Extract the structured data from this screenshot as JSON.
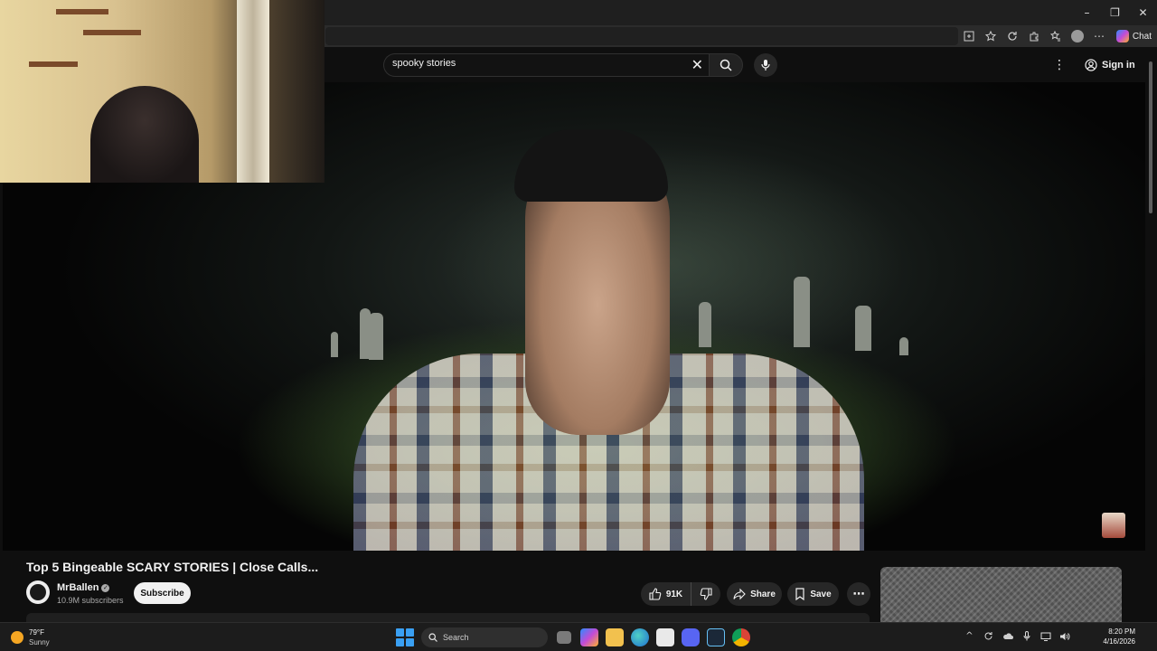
{
  "browser": {
    "minimize_glyph": "–",
    "maximize_glyph": "❐",
    "close_glyph": "✕",
    "chat_label": "Chat",
    "more_glyph": "⋯"
  },
  "youtube": {
    "search": {
      "value": "spooky stories",
      "clear_glyph": "✕"
    },
    "sign_in_label": "Sign in",
    "kebab_glyph": "⋮"
  },
  "video": {
    "title": "Top 5 Bingeable SCARY STORIES | Close Calls...",
    "channel_name": "MrBallen",
    "verified_glyph": "✓",
    "subscribers": "10.9M subscribers",
    "subscribe_label": "Subscribe",
    "likes": "91K",
    "share_label": "Share",
    "save_label": "Save",
    "more_glyph": "⋯"
  },
  "taskbar": {
    "weather_temp": "79°F",
    "weather_condition": "Sunny",
    "search_placeholder": "Search",
    "time": "8:20 PM",
    "date": "4/16/2026",
    "tray_chevron_glyph": "^"
  },
  "colors": {
    "page_bg": "#0f0f0f",
    "pill_bg": "#272727",
    "subscribe_bg": "#f1f1f1",
    "windows_blue": "#3aa0f3"
  }
}
